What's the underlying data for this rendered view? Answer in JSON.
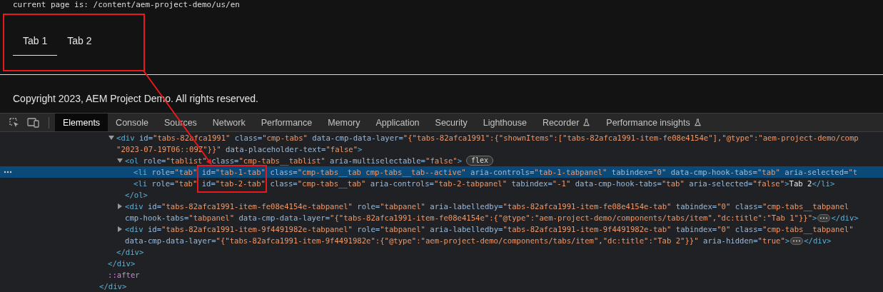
{
  "page": {
    "path_text": "current page is:  /content/aem-project-demo/us/en",
    "tabs": [
      {
        "label": "Tab 1",
        "selected": true
      },
      {
        "label": "Tab 2",
        "selected": false
      }
    ],
    "footer": "Copyright 2023, AEM Project Demo. All rights reserved."
  },
  "devtools": {
    "tabs": [
      {
        "label": "Elements",
        "selected": true,
        "experimental": false
      },
      {
        "label": "Console",
        "selected": false,
        "experimental": false
      },
      {
        "label": "Sources",
        "selected": false,
        "experimental": false
      },
      {
        "label": "Network",
        "selected": false,
        "experimental": false
      },
      {
        "label": "Performance",
        "selected": false,
        "experimental": false
      },
      {
        "label": "Memory",
        "selected": false,
        "experimental": false
      },
      {
        "label": "Application",
        "selected": false,
        "experimental": false
      },
      {
        "label": "Security",
        "selected": false,
        "experimental": false
      },
      {
        "label": "Lighthouse",
        "selected": false,
        "experimental": false
      },
      {
        "label": "Recorder",
        "selected": false,
        "experimental": true
      },
      {
        "label": "Performance insights",
        "selected": false,
        "experimental": true
      }
    ],
    "tree": [
      {
        "children": [
          {
            "children": [
              {
                "selected": false,
                "expanded": true,
                "lines": [
                  [
                    {
                      "kind": "tag",
                      "text": "<div"
                    },
                    {
                      "kind": "attr",
                      "text": " id="
                    },
                    {
                      "kind": "value",
                      "text": "\"tabs-82afca1991\""
                    },
                    {
                      "kind": "attr",
                      "text": " class="
                    },
                    {
                      "kind": "value",
                      "text": "\"cmp-tabs\""
                    },
                    {
                      "kind": "attr",
                      "text": " data-cmp-data-layer="
                    },
                    {
                      "kind": "value",
                      "text": "\"{\"tabs-82afca1991\":{\"shownItems\":[\"tabs-82afca1991-item-fe08e4154e\"],\"@type\":\"aem-project-demo/comp"
                    }
                  ],
                  [
                    {
                      "kind": "value",
                      "text": "\"2023-07-19T06:"
                    },
                    {
                      "kind": "value",
                      "text": ":09Z\"}}\""
                    },
                    {
                      "kind": "attr",
                      "text": " data-placeholder-text="
                    },
                    {
                      "kind": "value",
                      "text": "\"false\""
                    },
                    {
                      "kind": "tag",
                      "text": ">"
                    }
                  ]
                ],
                "children": [
                  {
                    "selected": false,
                    "expanded": true,
                    "badge": "flex",
                    "lines": [
                      [
                        {
                          "kind": "tag",
                          "text": "<ol"
                        },
                        {
                          "kind": "attr",
                          "text": " role="
                        },
                        {
                          "kind": "value",
                          "text": "\"tablist\""
                        },
                        {
                          "kind": "attr",
                          "text": " class="
                        },
                        {
                          "kind": "value",
                          "text": "\"cmp-tabs__tablist\""
                        },
                        {
                          "kind": "attr",
                          "text": " aria-multiselectable="
                        },
                        {
                          "kind": "value",
                          "text": "\"false\""
                        },
                        {
                          "kind": "tag",
                          "text": ">"
                        }
                      ]
                    ],
                    "children": [
                      {
                        "selected": true,
                        "lines": [
                          [
                            {
                              "kind": "tag",
                              "text": "<li"
                            },
                            {
                              "kind": "attr",
                              "text": " role="
                            },
                            {
                              "kind": "value",
                              "text": "\"tab\""
                            },
                            {
                              "kind": "attr",
                              "text": " id="
                            },
                            {
                              "kind": "value",
                              "text": "\"tab-1-tab\""
                            },
                            {
                              "kind": "attr",
                              "text": " class="
                            },
                            {
                              "kind": "value",
                              "text": "\"cmp-tabs__tab cmp-tabs__tab--active\""
                            },
                            {
                              "kind": "attr",
                              "text": " aria-controls="
                            },
                            {
                              "kind": "value",
                              "text": "\"tab-1-tabpanel\""
                            },
                            {
                              "kind": "attr",
                              "text": " tabindex="
                            },
                            {
                              "kind": "value",
                              "text": "\"0\""
                            },
                            {
                              "kind": "attr",
                              "text": " data-cmp-hook-tabs="
                            },
                            {
                              "kind": "value",
                              "text": "\"tab\""
                            },
                            {
                              "kind": "attr",
                              "text": " aria-selected="
                            },
                            {
                              "kind": "value",
                              "text": "\"t"
                            }
                          ]
                        ]
                      },
                      {
                        "selected": false,
                        "lines": [
                          [
                            {
                              "kind": "tag",
                              "text": "<li"
                            },
                            {
                              "kind": "attr",
                              "text": " role="
                            },
                            {
                              "kind": "value",
                              "text": "\"tab\""
                            },
                            {
                              "kind": "attr",
                              "text": " id="
                            },
                            {
                              "kind": "value",
                              "text": "\"tab-2-tab\""
                            },
                            {
                              "kind": "attr",
                              "text": " class="
                            },
                            {
                              "kind": "value",
                              "text": "\"cmp-tabs__tab\""
                            },
                            {
                              "kind": "attr",
                              "text": " aria-controls="
                            },
                            {
                              "kind": "value",
                              "text": "\"tab-2-tabpanel\""
                            },
                            {
                              "kind": "attr",
                              "text": " tabindex="
                            },
                            {
                              "kind": "value",
                              "text": "\"-1\""
                            },
                            {
                              "kind": "attr",
                              "text": " data-cmp-hook-tabs="
                            },
                            {
                              "kind": "value",
                              "text": "\"tab\""
                            },
                            {
                              "kind": "attr",
                              "text": " aria-selected="
                            },
                            {
                              "kind": "value",
                              "text": "\"false\""
                            },
                            {
                              "kind": "tag",
                              "text": ">"
                            },
                            {
                              "kind": "text",
                              "text": "Tab 2"
                            },
                            {
                              "kind": "tag",
                              "text": "</li>"
                            }
                          ]
                        ]
                      }
                    ],
                    "closing": [
                      {
                        "kind": "tag",
                        "text": "</ol>"
                      }
                    ]
                  },
                  {
                    "selected": false,
                    "expanded": false,
                    "lines": [
                      [
                        {
                          "kind": "tag",
                          "text": "<div"
                        },
                        {
                          "kind": "attr",
                          "text": " id="
                        },
                        {
                          "kind": "value",
                          "text": "\"tabs-82afca1991-item-fe08e4154e-tabpanel\""
                        },
                        {
                          "kind": "attr",
                          "text": " role="
                        },
                        {
                          "kind": "value",
                          "text": "\"tabpanel\""
                        },
                        {
                          "kind": "attr",
                          "text": " aria-labelledby="
                        },
                        {
                          "kind": "value",
                          "text": "\"tabs-82afca1991-item-fe08e4154e-tab\""
                        },
                        {
                          "kind": "attr",
                          "text": " tabindex="
                        },
                        {
                          "kind": "value",
                          "text": "\"0\""
                        },
                        {
                          "kind": "attr",
                          "text": " class="
                        },
                        {
                          "kind": "value",
                          "text": "\"cmp-tabs__tabpanel"
                        }
                      ],
                      [
                        {
                          "kind": "attr",
                          "text": "cmp-hook-tabs="
                        },
                        {
                          "kind": "value",
                          "text": "\"tabpanel\""
                        },
                        {
                          "kind": "attr",
                          "text": " data-cmp-data-layer="
                        },
                        {
                          "kind": "value",
                          "text": "\"{\"tabs-82afca1991-item-fe08e4154e\":{\"@type\":\"aem-project-demo/components/tabs/item\",\"dc:title\":\"Tab 1\"}}\""
                        },
                        {
                          "kind": "tag",
                          "text": ">"
                        },
                        {
                          "kind": "ellipsis"
                        },
                        {
                          "kind": "tag",
                          "text": "</div>"
                        }
                      ]
                    ]
                  },
                  {
                    "selected": false,
                    "expanded": false,
                    "lines": [
                      [
                        {
                          "kind": "tag",
                          "text": "<div"
                        },
                        {
                          "kind": "attr",
                          "text": " id="
                        },
                        {
                          "kind": "value",
                          "text": "\"tabs-82afca1991-item-9f4491982e-tabpanel\""
                        },
                        {
                          "kind": "attr",
                          "text": " role="
                        },
                        {
                          "kind": "value",
                          "text": "\"tabpanel\""
                        },
                        {
                          "kind": "attr",
                          "text": " aria-labelledby="
                        },
                        {
                          "kind": "value",
                          "text": "\"tabs-82afca1991-item-9f4491982e-tab\""
                        },
                        {
                          "kind": "attr",
                          "text": " tabindex="
                        },
                        {
                          "kind": "value",
                          "text": "\"0\""
                        },
                        {
                          "kind": "attr",
                          "text": " class="
                        },
                        {
                          "kind": "value",
                          "text": "\"cmp-tabs__tabpanel\""
                        }
                      ],
                      [
                        {
                          "kind": "attr",
                          "text": "data-cmp-data-layer="
                        },
                        {
                          "kind": "value",
                          "text": "\"{\"tabs-82afca1991-item-9f4491982e\":{\"@type\":\"aem-project-demo/components/tabs/item\",\"dc:title\":\"Tab 2\"}}\""
                        },
                        {
                          "kind": "attr",
                          "text": " aria-hidden="
                        },
                        {
                          "kind": "value",
                          "text": "\"true\""
                        },
                        {
                          "kind": "tag",
                          "text": ">"
                        },
                        {
                          "kind": "ellipsis"
                        },
                        {
                          "kind": "tag",
                          "text": "</div>"
                        }
                      ]
                    ]
                  }
                ],
                "closing": [
                  {
                    "kind": "tag",
                    "text": "</div>"
                  }
                ]
              }
            ],
            "closing": [
              {
                "kind": "tag",
                "text": "</div>"
              }
            ]
          },
          {
            "selected": false,
            "lines": [
              [
                {
                  "kind": "pseudo",
                  "text": "::after"
                }
              ]
            ]
          }
        ],
        "closing": [
          {
            "kind": "tag",
            "text": "</div>"
          }
        ]
      }
    ]
  }
}
